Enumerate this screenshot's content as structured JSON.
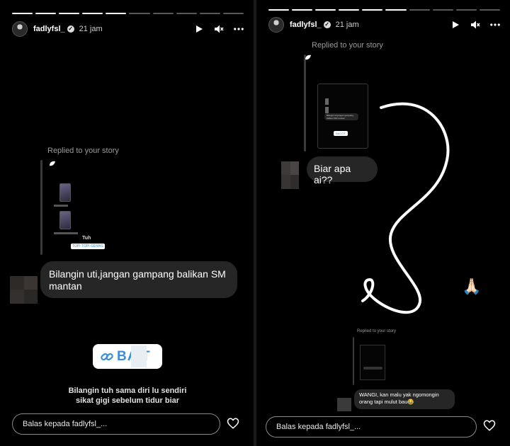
{
  "left_story": {
    "username": "fadlyfsl_",
    "time_ago": "21 jam",
    "replied_label": "Replied to your story",
    "preview_tag": "Tuh",
    "preview_sticker": "TOPI TOPI GEMAS",
    "message": "Bilangin uti,jangan gampang balikan SM mantan",
    "link_sticker_text": "BA T",
    "caption_line1": "Bilangin tuh sama diri lu sendiri",
    "caption_line2": "sikat gigi sebelum tidur biar",
    "reply_placeholder": "Balas kepada fadlyfsl_..."
  },
  "right_story": {
    "username": "fadlyfsl_",
    "time_ago": "21 jam",
    "replied_label": "Replied to your story",
    "preview_message": "Bilangin uti,jangan gampang balikan SM mantan",
    "preview_sticker": "BACOT",
    "message": "Biar apa ai??",
    "emoji": "🙏🏻",
    "nested_replied_label": "Replied to your story",
    "nested_message": "WANGI, kan malu yak ngomongin orang tapi mulut bau😂",
    "reply_placeholder": "Balas kepada fadlyfsl_..."
  },
  "colors": {
    "background": "#000000",
    "bubble": "#262626",
    "link_blue": "#3b8fd9"
  },
  "icons": [
    "play-icon",
    "mute-icon",
    "more-icon",
    "heart-icon",
    "link-icon",
    "verified-badge-icon",
    "sticker-icon"
  ]
}
